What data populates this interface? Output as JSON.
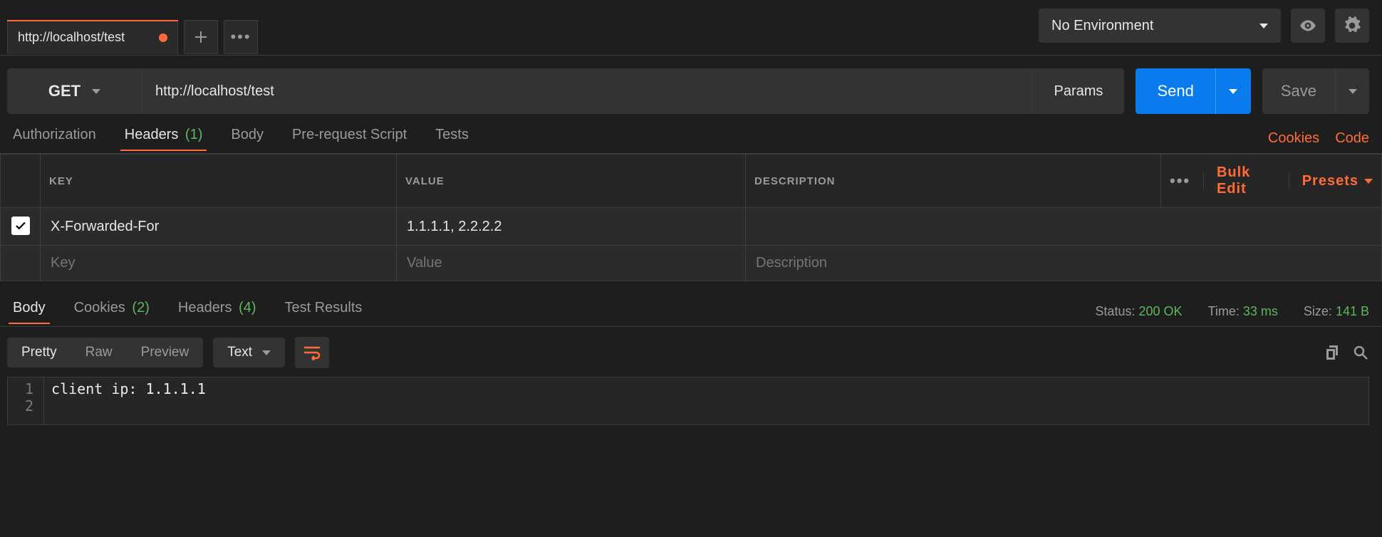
{
  "top": {
    "tab_title": "http://localhost/test",
    "env_label": "No Environment"
  },
  "request": {
    "method": "GET",
    "url": "http://localhost/test",
    "params_label": "Params",
    "send_label": "Send",
    "save_label": "Save"
  },
  "req_tabs": {
    "authorization": "Authorization",
    "headers_label": "Headers",
    "headers_count": "(1)",
    "body": "Body",
    "prescript": "Pre-request Script",
    "tests": "Tests",
    "cookies_link": "Cookies",
    "code_link": "Code"
  },
  "htable": {
    "col_key": "KEY",
    "col_value": "VALUE",
    "col_desc": "DESCRIPTION",
    "bulk_edit": "Bulk Edit",
    "presets": "Presets",
    "rows": [
      {
        "checked": true,
        "key": "X-Forwarded-For",
        "value": "1.1.1.1, 2.2.2.2",
        "desc": ""
      }
    ],
    "ph_key": "Key",
    "ph_value": "Value",
    "ph_desc": "Description"
  },
  "resp_tabs": {
    "body": "Body",
    "cookies_label": "Cookies",
    "cookies_count": "(2)",
    "headers_label": "Headers",
    "headers_count": "(4)",
    "tests": "Test Results"
  },
  "resp_meta": {
    "status_label": "Status:",
    "status_value": "200 OK",
    "time_label": "Time:",
    "time_value": "33 ms",
    "size_label": "Size:",
    "size_value": "141 B"
  },
  "resp_toolbar": {
    "pretty": "Pretty",
    "raw": "Raw",
    "preview": "Preview",
    "mode": "Text"
  },
  "resp_body": {
    "lines": [
      "client ip: 1.1.1.1",
      ""
    ]
  }
}
